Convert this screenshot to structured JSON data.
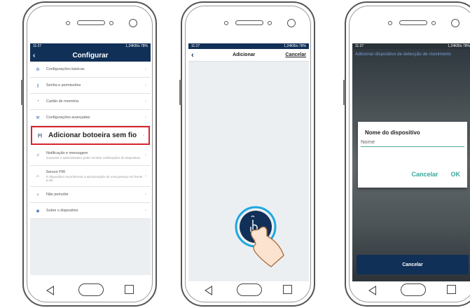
{
  "status": {
    "time": "11:27",
    "speed": "1,24KB/s",
    "battery": "78%"
  },
  "screen1": {
    "title": "Configurar",
    "items": [
      {
        "label": "Configurações básicas"
      },
      {
        "label": "Senha e permissões"
      },
      {
        "label": "Cartão de memória"
      },
      {
        "label": "Configurações avançadas"
      },
      {
        "label": "Adicionar botoeira sem fio"
      },
      {
        "label": "Notificação e mensagem",
        "sub": "Somente o administrador pode receber notificações do dispositivo"
      },
      {
        "label": "Sensor PIR",
        "sub": "O dispositivo reconhecerá a aproximação de uma pessoa em frente a ele"
      },
      {
        "label": "Não perturbe"
      },
      {
        "label": "Sobre o dispositivo"
      }
    ]
  },
  "screen2": {
    "title": "Adicionar",
    "cancel": "Cancelar"
  },
  "screen3": {
    "heading": "Adicionar dispositivo de detecção de movimento",
    "dialog_title": "Nome do dispositivo",
    "input_placeholder": "Nome",
    "dialog_cancel": "Cancelar",
    "dialog_ok": "OK",
    "cancel_button": "Cancelar"
  }
}
